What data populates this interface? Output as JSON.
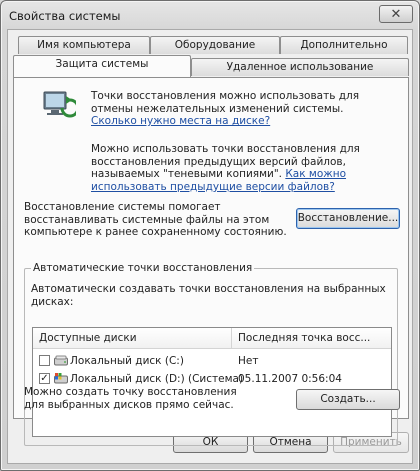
{
  "window": {
    "title": "Свойства системы",
    "close_glyph": "✕"
  },
  "tabs": {
    "row1": [
      "Имя компьютера",
      "Оборудование",
      "Дополнительно"
    ],
    "row2": [
      "Защита системы",
      "Удаленное использование"
    ],
    "active": "Защита системы"
  },
  "intro": {
    "text1": "Точки восстановления можно использовать для отмены нежелательных изменений системы.",
    "link1": "Сколько нужно места на диске?",
    "text2": "Можно использовать точки восстановления для восстановления предыдущих версий файлов, называемых \"теневыми копиями\".",
    "link2": "Как можно использовать предыдущие версии файлов?"
  },
  "restore": {
    "description": "Восстановление системы помогает восстанавливать системные файлы на этом компьютере к ранее сохраненному состоянию.",
    "button": "Восстановление..."
  },
  "auto_points": {
    "legend": "Автоматические точки восстановления",
    "caption": "Автоматически создавать точки восстановления на выбранных дисках:",
    "columns": [
      "Доступные диски",
      "Последняя точка восс..."
    ],
    "rows": [
      {
        "checked": false,
        "disk": "Локальный диск (C:)",
        "last_point": "Нет"
      },
      {
        "checked": true,
        "disk": "Локальный диск (D:) (Система)",
        "last_point": "05.11.2007 0:56:04"
      }
    ]
  },
  "create": {
    "description": "Можно создать точку восстановления для выбранных дисков прямо сейчас.",
    "button": "Создать..."
  },
  "footer": {
    "ok": "ОК",
    "cancel": "Отмена",
    "apply": "Применить"
  }
}
